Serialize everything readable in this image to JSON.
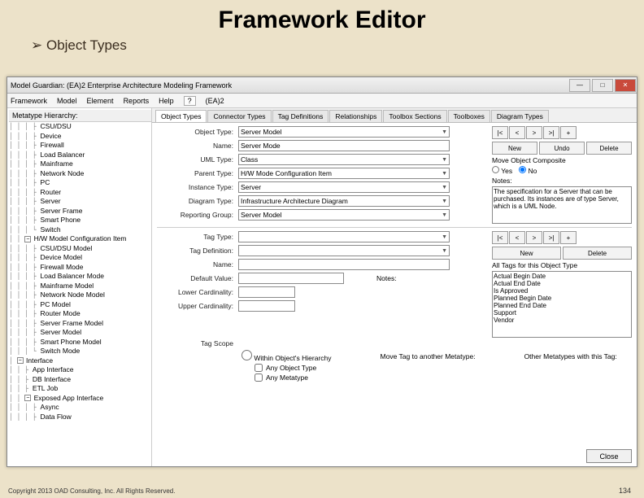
{
  "slide": {
    "title": "Framework Editor",
    "bullet": "Object Types",
    "copyright": "Copyright 2013 OAD Consulting, Inc. All Rights Reserved.",
    "pagenum": "134"
  },
  "window": {
    "title": "Model Guardian: (EA)2 Enterprise Architecture Modeling Framework",
    "menu": {
      "m1": "Framework",
      "m2": "Model",
      "m3": "Element",
      "m4": "Reports",
      "m5": "Help",
      "q": "?",
      "brand": "(EA)2"
    },
    "treelabel": "Metatype Hierarchy:",
    "tabs": {
      "t1": "Object Types",
      "t2": "Connector Types",
      "t3": "Tag Definitions",
      "t4": "Relationships",
      "t5": "Toolbox Sections",
      "t6": "Toolboxes",
      "t7": "Diagram Types"
    },
    "form": {
      "object_type_lbl": "Object Type:",
      "object_type_val": "Server Model",
      "name_lbl": "Name:",
      "name_val": "Server Mode",
      "uml_lbl": "UML Type:",
      "uml_val": "Class",
      "parent_lbl": "Parent Type:",
      "parent_val": "H/W Mode Configuration Item",
      "inst_lbl": "Instance Type:",
      "inst_val": "Server",
      "diag_lbl": "Diagram Type:",
      "diag_val": "Infrastructure Architecture Diagram",
      "rptgrp_lbl": "Reporting Group:",
      "rptgrp_val": "Server Model",
      "tagtype_lbl": "Tag Type:",
      "tagdef_lbl": "Tag Definition:",
      "tagname_lbl": "Name:",
      "defval_lbl": "Default Value:",
      "notes_lbl": "Notes:",
      "lcard_lbl": "Lower Cardinality:",
      "ucard_lbl": "Upper Cardinality:",
      "tagscope_lbl": "Tag Scope",
      "within_lbl": "Within Object's Hierarchy",
      "move_lbl": "Move Tag to another Metatype:",
      "other_lbl": "Other Metatypes with this Tag:",
      "anyobj_lbl": "Any Object Type",
      "anymeta_lbl": "Any Metatype",
      "nav_first": "|<",
      "nav_prev": "<",
      "nav_next": ">",
      "nav_last": ">|",
      "nav_plus": "+",
      "new": "New",
      "undo": "Undo",
      "delete": "Delete",
      "move_comp": "Move Object Composite",
      "yes": "Yes",
      "no": "No",
      "notes_hdr": "Notes:",
      "notes_text": "The specification for a Server that can be purchased. Its instances are of type Server, which is a UML Node.",
      "alltags_lbl": "All Tags for this Object Type",
      "alltags": {
        "a1": "Actual Begin Date",
        "a2": "Actual End Date",
        "a3": "Is Approved",
        "a4": "Planned Begin Date",
        "a5": "Planned End Date",
        "a6": "Support",
        "a7": "Vendor"
      },
      "close": "Close"
    },
    "tree": {
      "i0": "CSU/DSU",
      "i1": "Device",
      "i2": "Firewall",
      "i3": "Load Balancer",
      "i4": "Mainframe",
      "i5": "Network Node",
      "i6": "PC",
      "i7": "Router",
      "i8": "Server",
      "i9": "Server Frame",
      "i10": "Smart Phone",
      "i11": "Switch",
      "grp1": "H/W Model Configuration Item",
      "i12": "CSU/DSU Model",
      "i13": "Device Model",
      "i14": "Firewall Mode",
      "i15": "Load Balancer Mode",
      "i16": "Mainframe Model",
      "i17": "Network Node Model",
      "i18": "PC Model",
      "i19": "Router Mode",
      "i20": "Server Frame Model",
      "i21": "Server Model",
      "i22": "Smart Phone Model",
      "i23": "Switch Mode",
      "grp2": "Interface",
      "i24": "App Interface",
      "i25": "DB Interface",
      "i26": "ETL Job",
      "grp3": "Exposed App Interface",
      "i27": "Async",
      "i28": "Data Flow"
    }
  }
}
